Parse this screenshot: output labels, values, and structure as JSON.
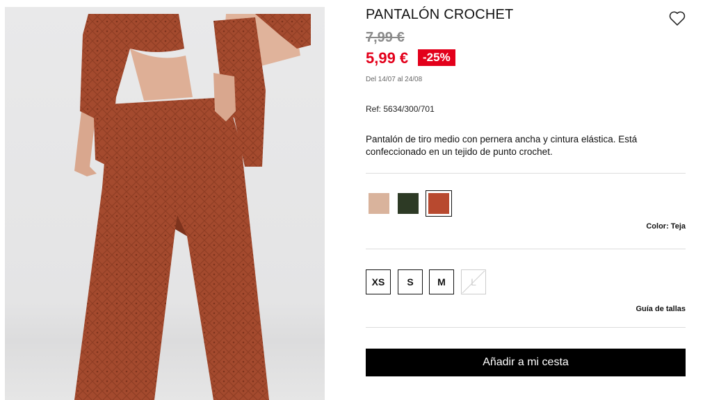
{
  "product": {
    "title": "PANTALÓN CROCHET",
    "old_price": "7,99 €",
    "new_price": "5,99 €",
    "discount": "-25%",
    "dates": "Del 14/07 al 24/08",
    "ref": "Ref: 5634/300/701",
    "description": "Pantalón de tiro medio con pernera ancha y cintura elástica. Está confeccionado en un tejido de punto crochet."
  },
  "colors": {
    "label": "Color: Teja",
    "options": [
      {
        "color": "#d9b39c"
      },
      {
        "color": "#2d3a25"
      },
      {
        "color": "#b8492f"
      }
    ],
    "selected_index": 2
  },
  "sizes": {
    "options": [
      {
        "label": "XS",
        "available": true
      },
      {
        "label": "S",
        "available": true
      },
      {
        "label": "M",
        "available": true
      },
      {
        "label": "L",
        "available": false
      }
    ],
    "guide_label": "Guía de tallas"
  },
  "cta": {
    "add_to_cart": "Añadir a mi cesta"
  },
  "theme": {
    "accent": "#e3001b",
    "garment": "#a44a2e"
  }
}
